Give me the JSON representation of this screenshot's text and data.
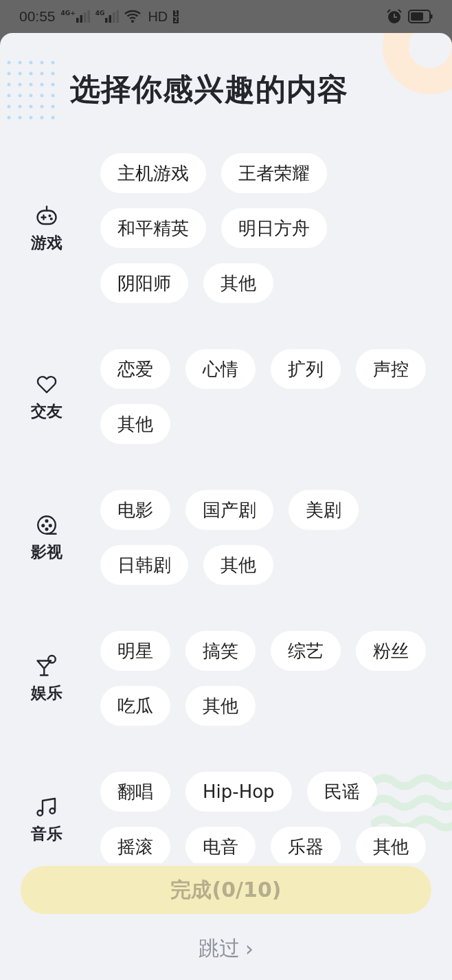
{
  "status_bar": {
    "time": "00:55",
    "networks": [
      "4G+",
      "4G"
    ],
    "hd": "HD",
    "hd_slots": [
      "1",
      "2"
    ]
  },
  "title": "选择你感兴趣的内容",
  "categories": [
    {
      "kind": "gamepad",
      "label": "游戏",
      "tags": [
        {
          "label": "主机游戏",
          "selected": false
        },
        {
          "label": "王者荣耀",
          "selected": false
        },
        {
          "label": "和平精英",
          "selected": false
        },
        {
          "label": "明日方舟",
          "selected": false
        },
        {
          "label": "阴阳师",
          "selected": false
        },
        {
          "label": "其他",
          "selected": false
        }
      ]
    },
    {
      "kind": "heart",
      "label": "交友",
      "tags": [
        {
          "label": "恋爱",
          "selected": false
        },
        {
          "label": "心情",
          "selected": false
        },
        {
          "label": "扩列",
          "selected": false
        },
        {
          "label": "声控",
          "selected": false
        },
        {
          "label": "其他",
          "selected": false
        }
      ]
    },
    {
      "kind": "reel",
      "label": "影视",
      "tags": [
        {
          "label": "电影",
          "selected": false
        },
        {
          "label": "国产剧",
          "selected": false
        },
        {
          "label": "美剧",
          "selected": false
        },
        {
          "label": "日韩剧",
          "selected": false
        },
        {
          "label": "其他",
          "selected": false
        }
      ]
    },
    {
      "kind": "cocktail",
      "label": "娱乐",
      "tags": [
        {
          "label": "明星",
          "selected": false
        },
        {
          "label": "搞笑",
          "selected": false
        },
        {
          "label": "综艺",
          "selected": false
        },
        {
          "label": "粉丝",
          "selected": false
        },
        {
          "label": "吃瓜",
          "selected": false
        },
        {
          "label": "其他",
          "selected": false
        }
      ]
    },
    {
      "kind": "music",
      "label": "音乐",
      "tags": [
        {
          "label": "翻唱",
          "selected": false
        },
        {
          "label": "Hip-Hop",
          "selected": false
        },
        {
          "label": "民谣",
          "selected": false
        },
        {
          "label": "摇滚",
          "selected": false
        },
        {
          "label": "电音",
          "selected": false
        },
        {
          "label": "乐器",
          "selected": false
        },
        {
          "label": "其他",
          "selected": false
        }
      ]
    }
  ],
  "done_button": {
    "label": "完成(0/10)",
    "disabled": true
  },
  "skip_link": {
    "label": "跳过",
    "arrow": "›"
  }
}
